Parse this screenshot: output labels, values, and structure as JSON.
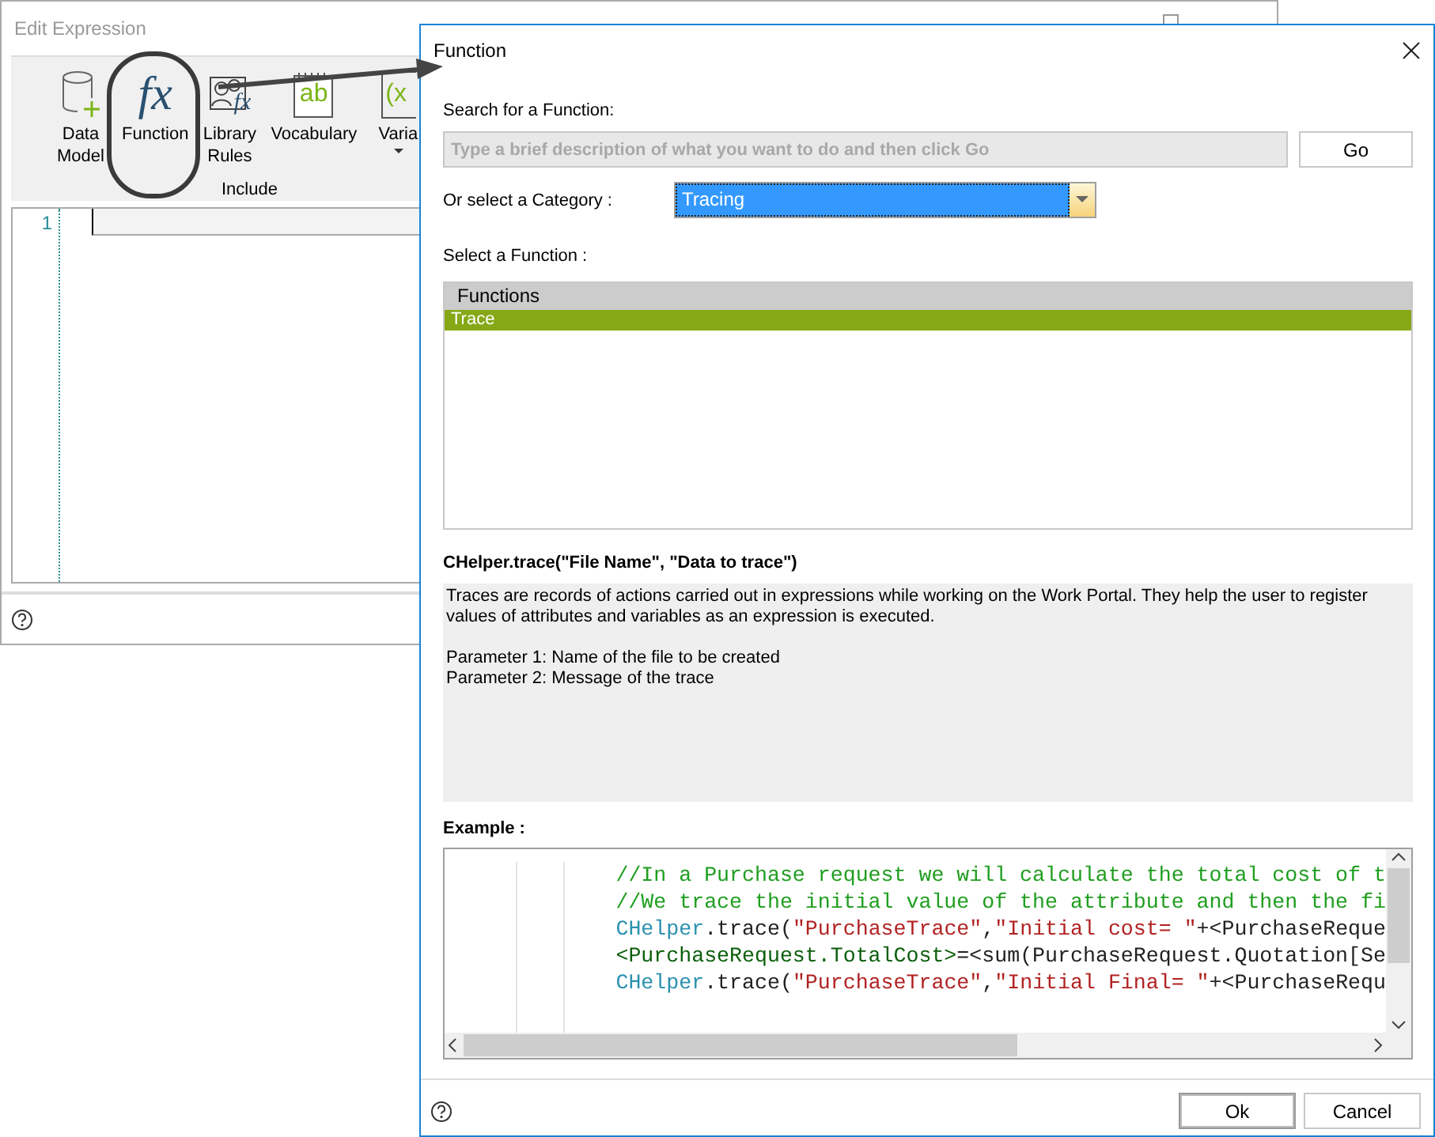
{
  "back_window": {
    "title": "Edit Expression",
    "active": false,
    "ribbon": {
      "items": [
        {
          "label": "Data Model",
          "kind": "database",
          "dropdown": false
        },
        {
          "label": "Function",
          "kind": "function",
          "icon_text": "fx",
          "dropdown": false
        },
        {
          "label": "Library Rules",
          "kind": "library",
          "icon_text": "fx",
          "dropdown": false
        },
        {
          "label": "Vocabulary",
          "kind": "vocabulary",
          "icon_text": "ab",
          "dropdown": false
        },
        {
          "label": "Varia",
          "kind": "variable",
          "icon_text": "(x",
          "dropdown": true
        }
      ],
      "group_label": "Include"
    },
    "editor": {
      "line_numbers": [
        "1"
      ]
    }
  },
  "dialog": {
    "title": "Function",
    "search_label": "Search for a Function:",
    "search": {
      "placeholder": "Type a brief description of what you want to do and then click Go"
    },
    "go_button": "Go",
    "category_label": "Or select a Category :",
    "category": {
      "value": "Tracing"
    },
    "function_label": "Select a Function :",
    "functions_header": "Functions",
    "functions": [
      {
        "name": "Trace",
        "selected": true
      }
    ],
    "signature": "CHelper.trace(\"File Name\", \"Data to trace\")",
    "description": [
      "Traces are records of actions carried out in expressions while working on the Work Portal. They help the user to register values of attributes and variables as an expression is executed.",
      "Parameter 1: Name of the file to be created",
      "Parameter 2: Message of the trace"
    ],
    "example_label": "Example :",
    "example_code": [
      [
        {
          "kind": "comment",
          "text": "//In a Purchase request we will calculate the total cost of t"
        }
      ],
      [
        {
          "kind": "comment",
          "text": "//We trace the initial value of the attribute and then the fi"
        }
      ],
      [
        {
          "kind": "class",
          "text": "CHelper"
        },
        {
          "kind": "plain",
          "text": ".trace("
        },
        {
          "kind": "string",
          "text": "\"PurchaseTrace\""
        },
        {
          "kind": "plain",
          "text": ","
        },
        {
          "kind": "string",
          "text": "\"Initial cost= \""
        },
        {
          "kind": "plain",
          "text": "+<PurchaseReque"
        }
      ],
      [
        {
          "kind": "attribute",
          "text": "<PurchaseRequest.TotalCost>"
        },
        {
          "kind": "plain",
          "text": "=<sum(PurchaseRequest.Quotation[Se"
        }
      ],
      [
        {
          "kind": "class",
          "text": "CHelper"
        },
        {
          "kind": "plain",
          "text": ".trace("
        },
        {
          "kind": "string",
          "text": "\"PurchaseTrace\""
        },
        {
          "kind": "plain",
          "text": ","
        },
        {
          "kind": "string",
          "text": "\"Initial Final= \""
        },
        {
          "kind": "plain",
          "text": "+<PurchaseRequ"
        }
      ]
    ],
    "buttons": [
      {
        "label": "Ok",
        "default": true
      },
      {
        "label": "Cancel",
        "default": false
      }
    ]
  }
}
